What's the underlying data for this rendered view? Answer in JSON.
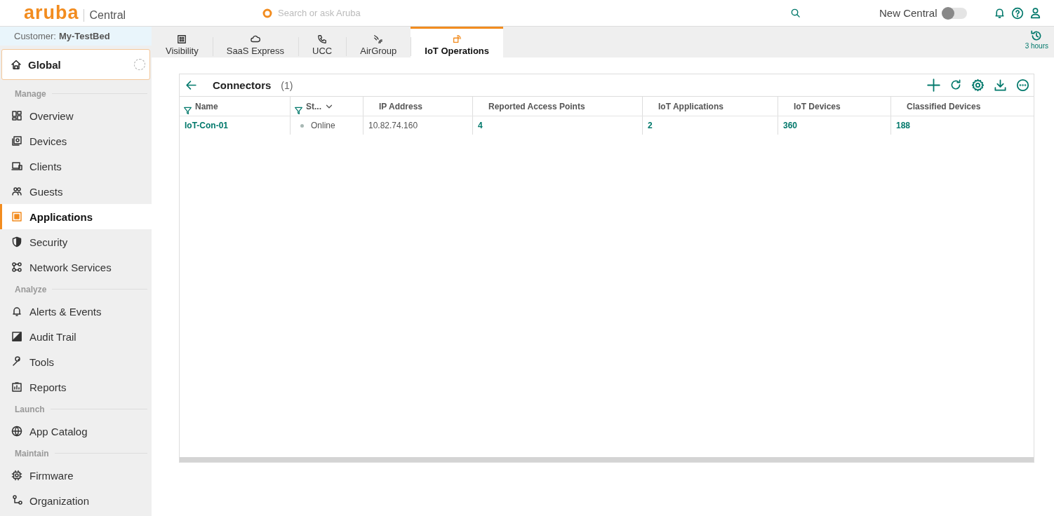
{
  "header": {
    "logo": "aruba",
    "product": "Central",
    "search": {
      "placeholder": "Search or ask Aruba"
    },
    "toggle": {
      "label": "New Central",
      "on": false
    }
  },
  "sidebar": {
    "customer": {
      "label": "Customer:",
      "name": "My-TestBed"
    },
    "scope": "Global",
    "sections": [
      {
        "title": "Manage",
        "items": [
          {
            "label": "Overview",
            "selected": false
          },
          {
            "label": "Devices",
            "selected": false
          },
          {
            "label": "Clients",
            "selected": false
          },
          {
            "label": "Guests",
            "selected": false
          },
          {
            "label": "Applications",
            "selected": true
          },
          {
            "label": "Security",
            "selected": false
          },
          {
            "label": "Network Services",
            "selected": false
          }
        ]
      },
      {
        "title": "Analyze",
        "items": [
          {
            "label": "Alerts & Events",
            "selected": false
          },
          {
            "label": "Audit Trail",
            "selected": false
          },
          {
            "label": "Tools",
            "selected": false
          },
          {
            "label": "Reports",
            "selected": false
          }
        ]
      },
      {
        "title": "Launch",
        "items": [
          {
            "label": "App Catalog",
            "selected": false
          }
        ]
      },
      {
        "title": "Maintain",
        "items": [
          {
            "label": "Firmware",
            "selected": false
          },
          {
            "label": "Organization",
            "selected": false
          }
        ]
      }
    ]
  },
  "tabs": [
    {
      "label": "Visibility",
      "selected": false
    },
    {
      "label": "SaaS Express",
      "selected": false
    },
    {
      "label": "UCC",
      "selected": false
    },
    {
      "label": "AirGroup",
      "selected": false
    },
    {
      "label": "IoT Operations",
      "selected": true
    }
  ],
  "time_range": "3 hours",
  "table": {
    "title": "Connectors",
    "count": "(1)",
    "columns": [
      {
        "label": "Name",
        "kind": "link",
        "filter": true,
        "dropdown": false
      },
      {
        "label": "St...",
        "kind": "status",
        "filter": true,
        "dropdown": true
      },
      {
        "label": "IP Address",
        "kind": "text",
        "filter": false,
        "dropdown": false
      },
      {
        "label": "Reported Access Points",
        "kind": "link",
        "filter": false,
        "dropdown": false
      },
      {
        "label": "IoT Applications",
        "kind": "link",
        "filter": false,
        "dropdown": false
      },
      {
        "label": "IoT Devices",
        "kind": "link",
        "filter": false,
        "dropdown": false
      },
      {
        "label": "Classified Devices",
        "kind": "link",
        "filter": false,
        "dropdown": false
      }
    ],
    "rows": [
      {
        "color": "#a8b8b4",
        "cells": [
          "IoT-Con-01",
          "Online",
          "10.82.74.160",
          "4",
          "2",
          "360",
          "188"
        ]
      }
    ]
  }
}
